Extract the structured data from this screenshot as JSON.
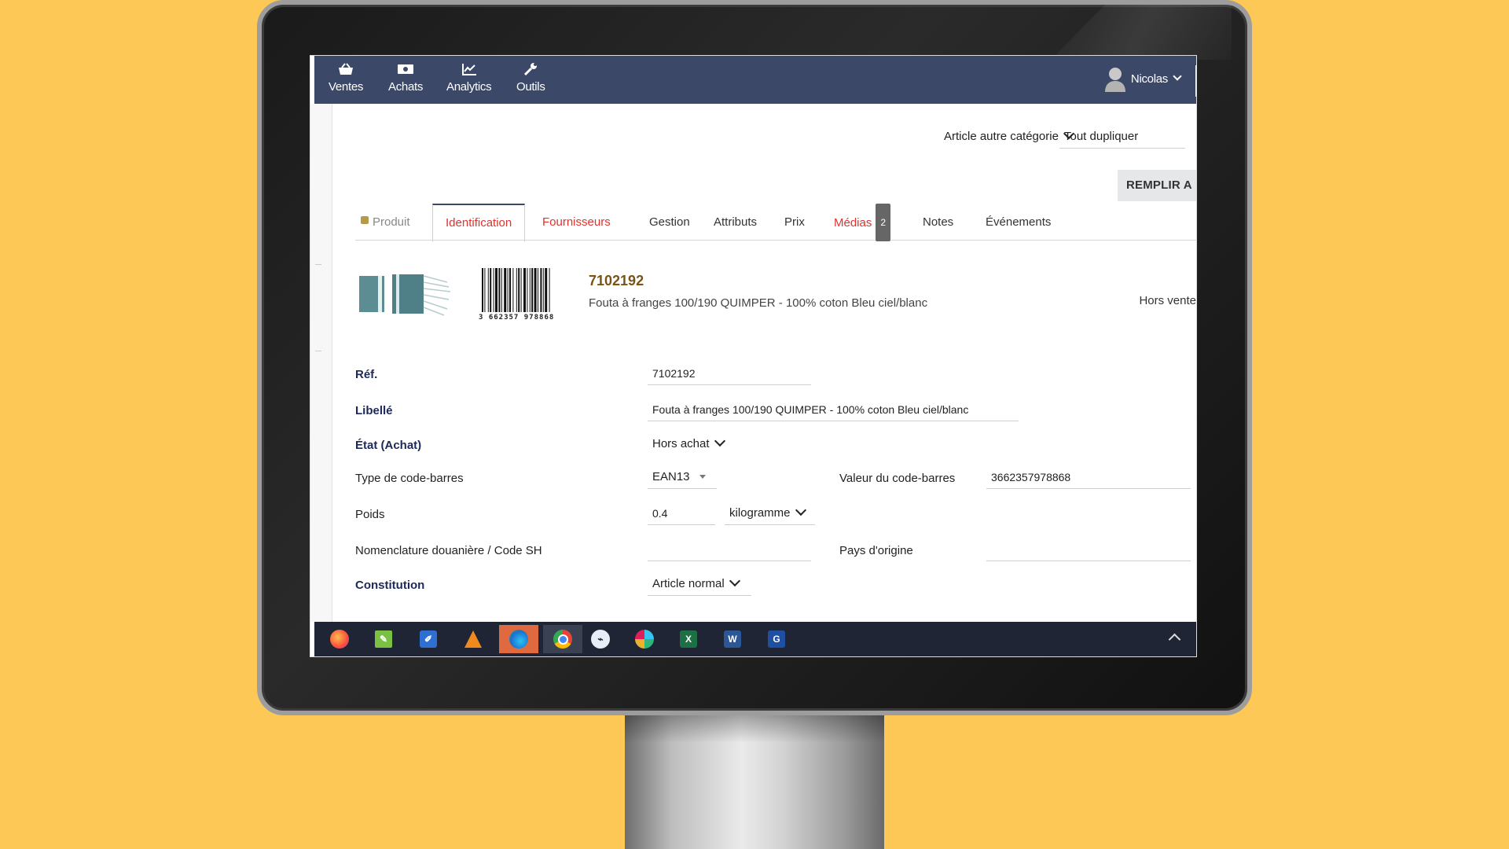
{
  "nav": {
    "items": [
      {
        "label": "Ventes",
        "icon": "basket-icon"
      },
      {
        "label": "Achats",
        "icon": "money-icon"
      },
      {
        "label": "Analytics",
        "icon": "chart-icon"
      },
      {
        "label": "Outils",
        "icon": "wrench-icon"
      }
    ],
    "user": "Nicolas"
  },
  "toolbar": {
    "category_select": "Article autre catégorie",
    "duplicate_select": "Tout dupliquer",
    "fill_button": "REMPLIR A"
  },
  "tabs": [
    {
      "label": "Produit"
    },
    {
      "label": "Identification"
    },
    {
      "label": "Fournisseurs"
    },
    {
      "label": "Gestion"
    },
    {
      "label": "Attributs"
    },
    {
      "label": "Prix"
    },
    {
      "label": "Médias",
      "badge": "2"
    },
    {
      "label": "Notes"
    },
    {
      "label": "Événements"
    }
  ],
  "product": {
    "code": "7102192",
    "description": "Fouta à franges 100/190 QUIMPER - 100% coton Bleu ciel/blanc",
    "status": "Hors vente",
    "barcode_text": "3 662357 978868"
  },
  "form": {
    "ref_label": "Réf.",
    "ref_value": "7102192",
    "libelle_label": "Libellé",
    "libelle_value": "Fouta à franges 100/190 QUIMPER - 100% coton Bleu ciel/blanc",
    "etat_label": "État (Achat)",
    "etat_value": "Hors achat",
    "barcode_type_label": "Type de code-barres",
    "barcode_type_value": "EAN13",
    "barcode_value_label": "Valeur du code-barres",
    "barcode_value": "3662357978868",
    "poids_label": "Poids",
    "poids_value": "0.4",
    "poids_unit": "kilogramme",
    "nomenclature_label": "Nomenclature douanière / Code SH",
    "nomenclature_value": "",
    "pays_label": "Pays d'origine",
    "pays_value": "",
    "constitution_label": "Constitution",
    "constitution_value": "Article normal"
  },
  "taskbar": {
    "apps": [
      "firefox-icon",
      "notepad-icon",
      "editor-icon",
      "vlc-icon",
      "edge-icon",
      "chrome-icon",
      "remote-icon",
      "slack-icon",
      "excel-icon",
      "word-icon",
      "pdf-icon"
    ]
  },
  "colors": {
    "background": "#fdc855",
    "nav": "#3b4868",
    "accent_red": "#e0322e",
    "label_blue": "#1d2858",
    "code_brown": "#7a5416"
  }
}
